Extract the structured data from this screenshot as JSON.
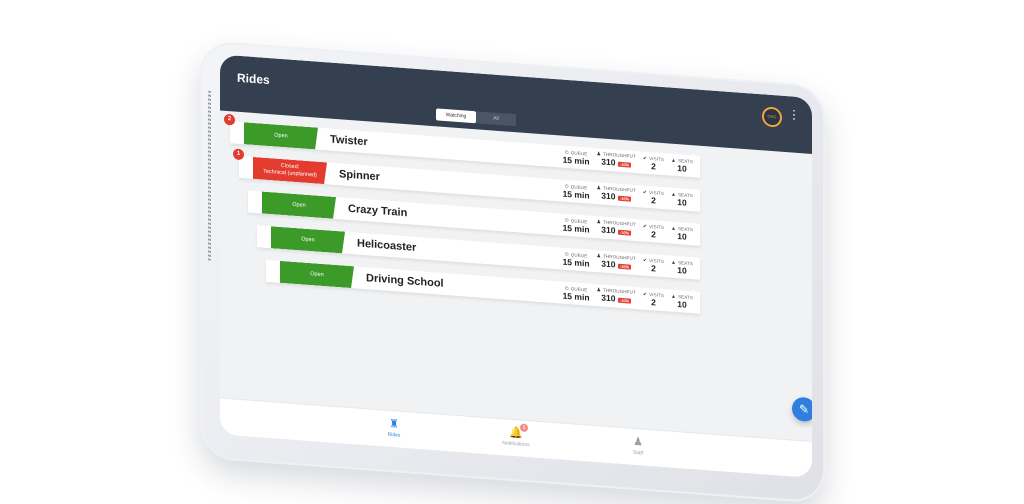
{
  "app": {
    "title": "Rides",
    "avatar_text": "OVG"
  },
  "filter": {
    "options": [
      "Watching",
      "All"
    ],
    "selected": "Watching"
  },
  "metric_labels": {
    "queue": "QUEUE",
    "throughput": "THROUGHPUT",
    "visits": "VISITS",
    "seats": "SEATS"
  },
  "rides": [
    {
      "badge": "2",
      "status": "Open",
      "status_kind": "open",
      "name": "Twister",
      "queue": "15 min",
      "throughput": "310",
      "delta": "-10%",
      "visits": "2",
      "seats": "10"
    },
    {
      "badge": "1",
      "status": "Closed:\nTechnical (unplanned)",
      "status_kind": "closed",
      "name": "Spinner",
      "queue": "15 min",
      "throughput": "310",
      "delta": "-10%",
      "visits": "2",
      "seats": "10"
    },
    {
      "badge": "",
      "status": "Open",
      "status_kind": "open",
      "name": "Crazy Train",
      "queue": "15 min",
      "throughput": "310",
      "delta": "-10%",
      "visits": "2",
      "seats": "10"
    },
    {
      "badge": "",
      "status": "Open",
      "status_kind": "open",
      "name": "Helicoaster",
      "queue": "15 min",
      "throughput": "310",
      "delta": "-10%",
      "visits": "2",
      "seats": "10"
    },
    {
      "badge": "",
      "status": "Open",
      "status_kind": "open",
      "name": "Driving School",
      "queue": "15 min",
      "throughput": "310",
      "delta": "-10%",
      "visits": "2",
      "seats": "10"
    }
  ],
  "nav": {
    "rides": "Rides",
    "notifications": "Notifications",
    "notifications_badge": "3",
    "staff": "Staff"
  },
  "colors": {
    "appbar": "#343f50",
    "open": "#3b9a28",
    "closed": "#e33b2e",
    "accent": "#2f7fe0"
  }
}
